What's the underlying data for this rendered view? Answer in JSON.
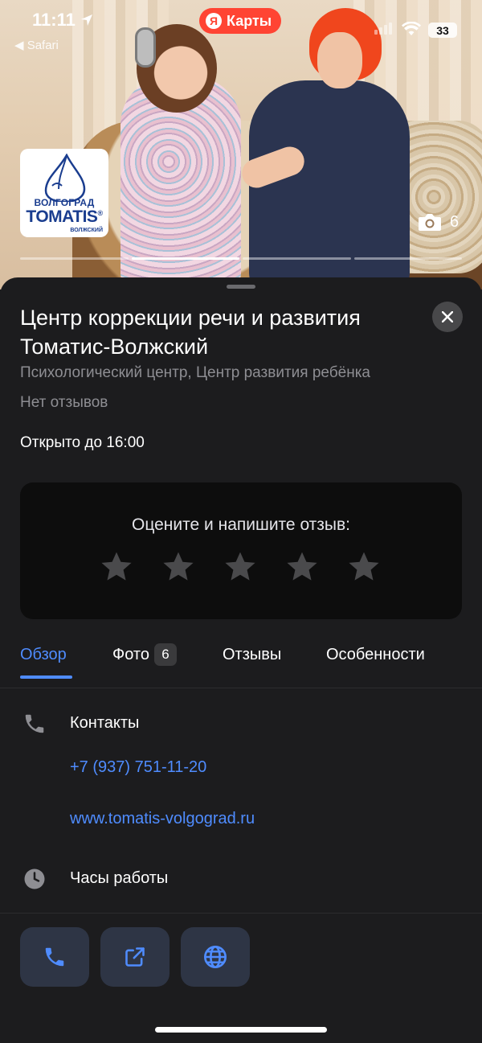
{
  "status_bar": {
    "time": "11:11",
    "back_app": "◀ Safari",
    "app_pill": {
      "ya": "Я",
      "label": "Карты"
    },
    "battery": "33"
  },
  "hero": {
    "logo": {
      "line1": "ВОЛГОГРАД",
      "line2": "TOMATIS",
      "registered": "®",
      "line3": "ВОЛЖСКИЙ"
    },
    "photo_count": "6",
    "progress_segments": 4,
    "progress_active": 2
  },
  "place": {
    "title": "Центр коррекции речи и развития Томатис-Волжский",
    "categories": "Психологический центр, Центр развития ребёнка",
    "reviews_summary": "Нет отзывов",
    "open_status": "Открыто до 16:00"
  },
  "rating_card": {
    "prompt": "Оцените и напишите отзыв:",
    "stars": 5
  },
  "tabs": [
    {
      "label": "Обзор",
      "active": true
    },
    {
      "label": "Фото",
      "badge": "6"
    },
    {
      "label": "Отзывы"
    },
    {
      "label": "Особенности"
    }
  ],
  "contacts": {
    "heading": "Контакты",
    "phone": "+7 (937) 751-11-20",
    "website": "www.tomatis-volgograd.ru",
    "icon": "phone-icon"
  },
  "hours": {
    "heading": "Часы работы",
    "icon": "clock-icon"
  },
  "actions": [
    {
      "name": "call",
      "icon": "phone-icon"
    },
    {
      "name": "share",
      "icon": "share-icon"
    },
    {
      "name": "website",
      "icon": "globe-icon"
    }
  ],
  "colors": {
    "accent": "#4f8cff",
    "sheet_bg": "#1c1c1e",
    "card_bg": "#0d0d0d",
    "action_bg": "#2e3545",
    "yandex_red": "#ff4433"
  }
}
